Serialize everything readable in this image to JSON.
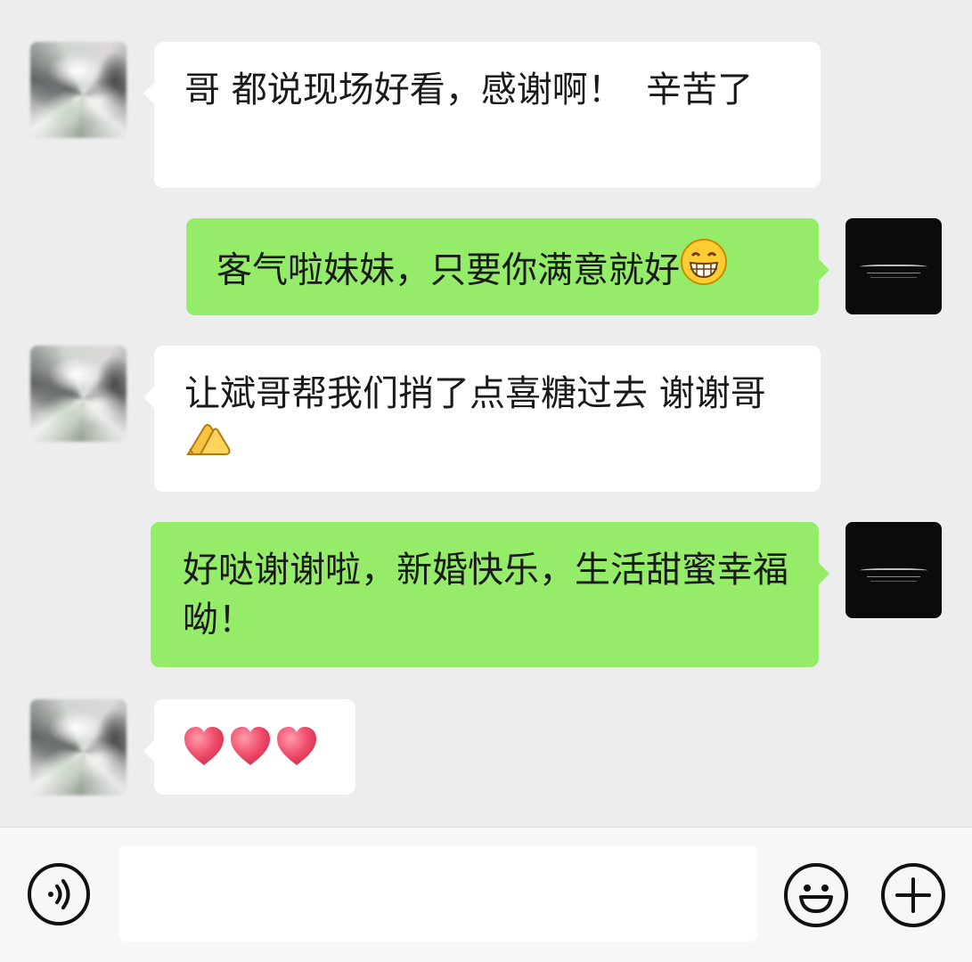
{
  "messages": [
    {
      "sender": "peer",
      "text": "哥 都说现场好看，感谢啊！  辛苦了"
    },
    {
      "sender": "me",
      "text": "客气啦妹妹，只要你满意就好",
      "trailing_emoji": "grinning-face-icon"
    },
    {
      "sender": "peer",
      "text": "让斌哥帮我们捎了点喜糖过去 谢谢哥",
      "trailing_emoji": "thank-you-hands-icon"
    },
    {
      "sender": "me",
      "text": "好哒谢谢啦，新婚快乐，生活甜蜜幸福呦！"
    },
    {
      "sender": "peer",
      "emojis": [
        "heart-icon",
        "heart-icon",
        "heart-icon"
      ]
    }
  ],
  "input_bar": {
    "voice_icon": "voice-icon",
    "message_value": "",
    "emoji_icon": "smiley-icon",
    "more_icon": "plus-icon"
  },
  "colors": {
    "background": "#ededed",
    "peer_bubble": "#ffffff",
    "my_bubble": "#95ec69",
    "heart": "#f0506e"
  }
}
